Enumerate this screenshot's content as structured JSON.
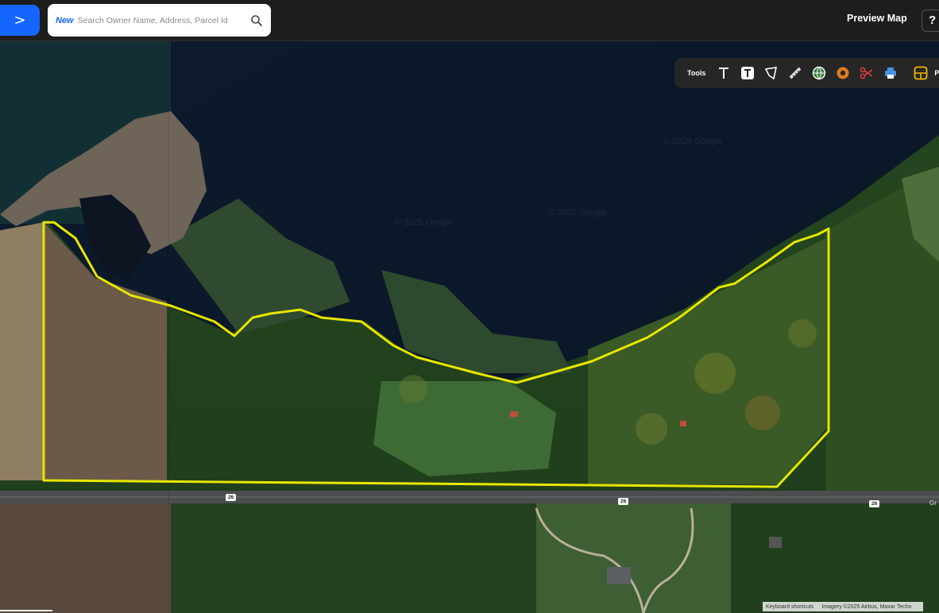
{
  "header": {
    "nav_button_label": ">",
    "search": {
      "tag": "New",
      "placeholder": "Search Owner Name, Address, Parcel Id"
    },
    "preview_map_label": "Preview Map",
    "help_label": "?"
  },
  "toolbar": {
    "label": "Tools",
    "tools": [
      {
        "name": "text-tool",
        "icon": "text-icon"
      },
      {
        "name": "text-box-tool",
        "icon": "text-box-icon"
      },
      {
        "name": "polygon-tool",
        "icon": "polygon-icon"
      },
      {
        "name": "measure-tool",
        "icon": "ruler-icon"
      },
      {
        "name": "globe-tool",
        "icon": "globe-icon"
      },
      {
        "name": "buffer-tool",
        "icon": "ring-icon"
      },
      {
        "name": "cut-tool",
        "icon": "scissors-icon"
      },
      {
        "name": "print-tool",
        "icon": "printer-icon"
      },
      {
        "name": "layout-tool",
        "icon": "layout-icon"
      }
    ],
    "trailing_label": "P"
  },
  "map": {
    "type": "satellite",
    "watermarks": [
      "© 2025 Google",
      "© 2025 Google",
      "© 2025 Google"
    ],
    "road_shields": [
      "26",
      "26",
      "26"
    ],
    "road_label": "Gr",
    "parcel_outline_color": "#e8e600",
    "attribution": {
      "shortcuts": "Keyboard shortcuts",
      "imagery": "Imagery ©2025 Airbus, Maxar Techn"
    }
  },
  "colors": {
    "accent": "#1466ff",
    "topbar": "#1d1d1d",
    "toolbar": "#262626"
  }
}
